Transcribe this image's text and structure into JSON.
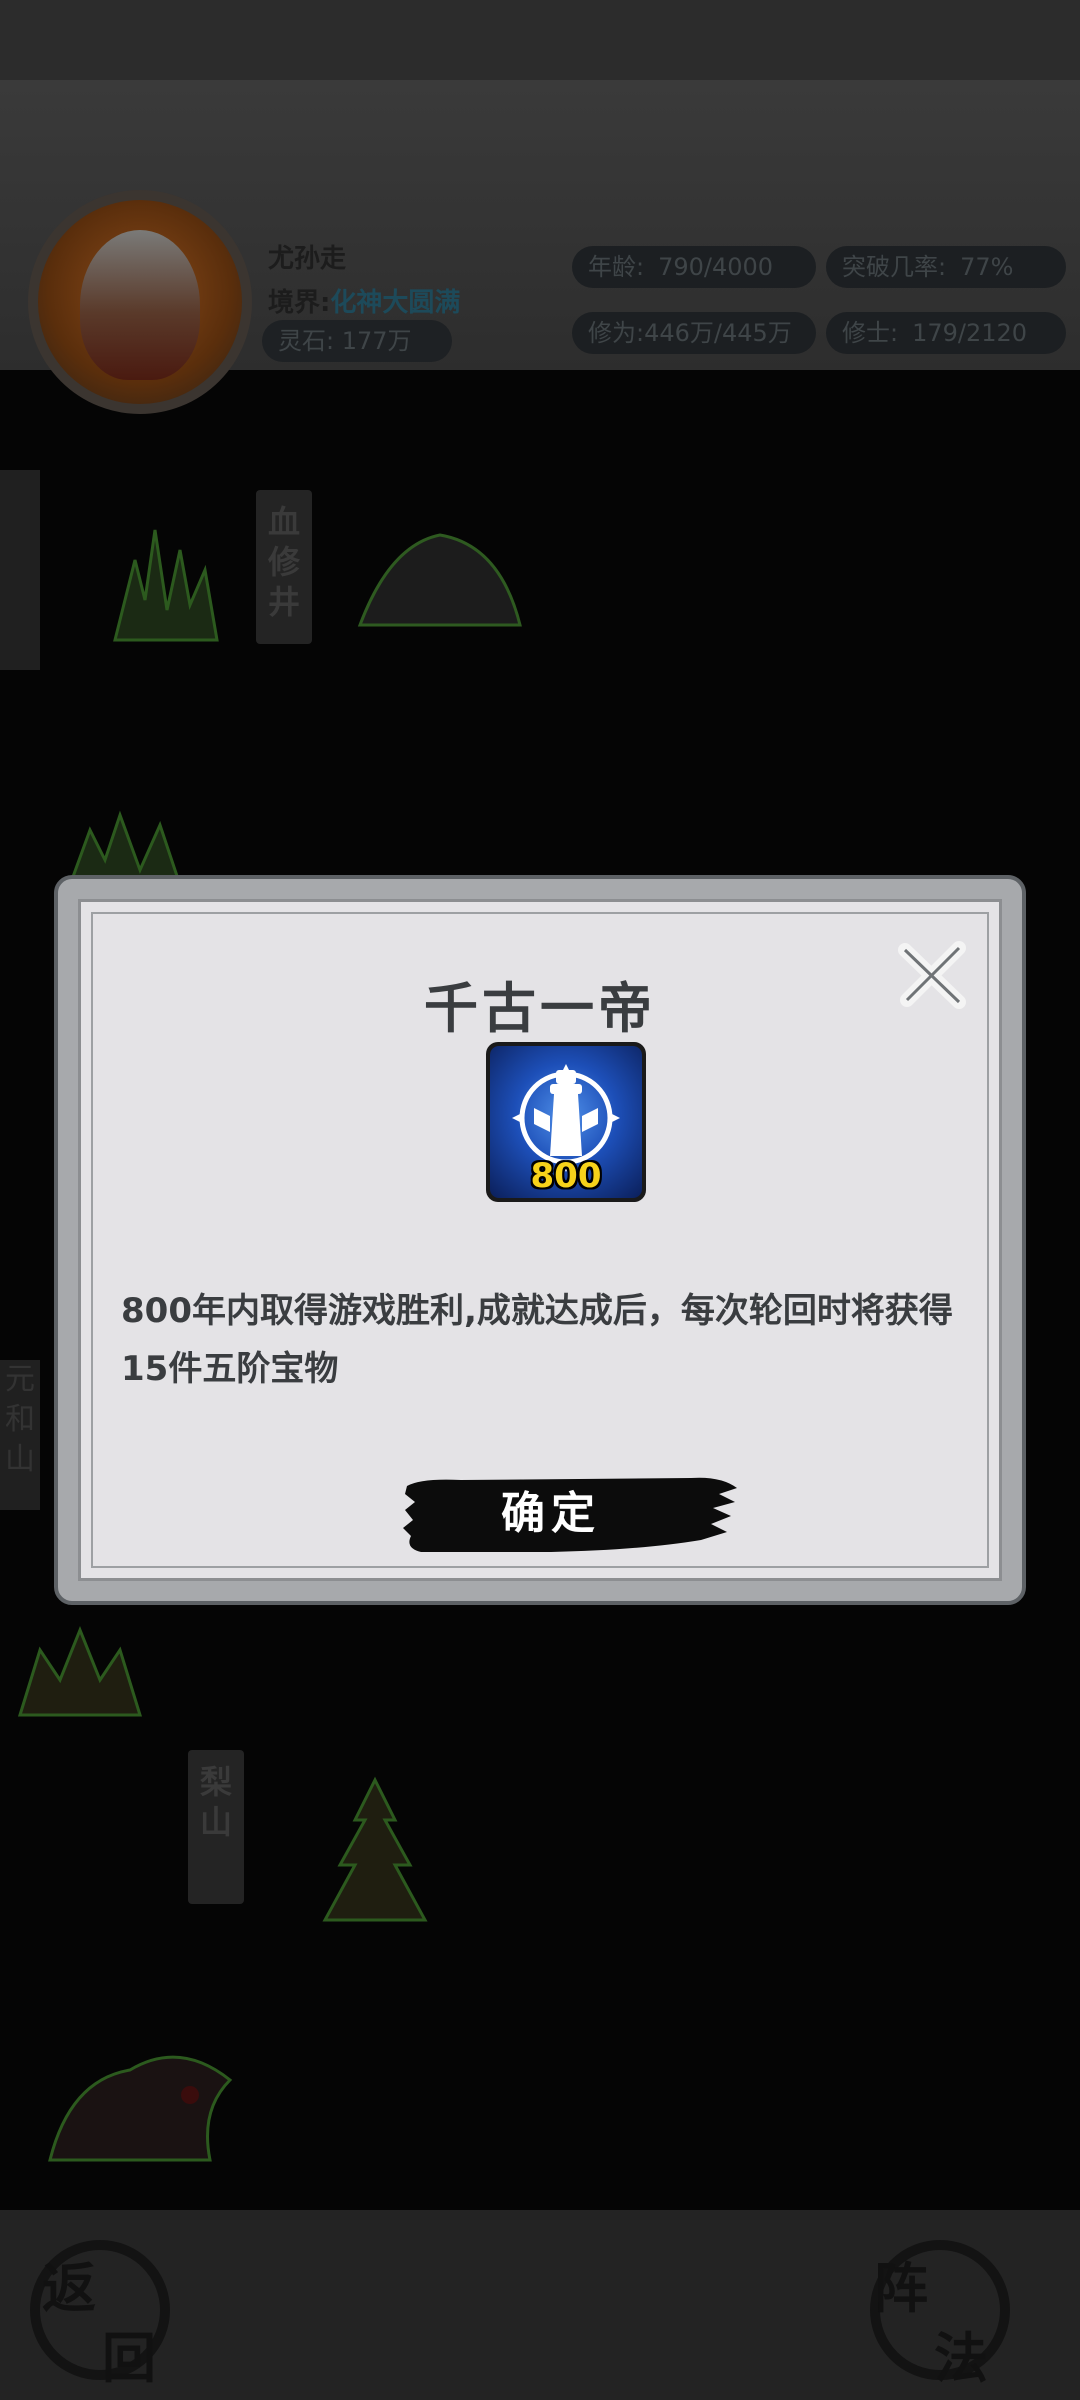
{
  "player": {
    "name": "尤孙走",
    "realm_label": "境界:",
    "realm_value": "化神大圆满",
    "spirit_stone": "灵石: 177万"
  },
  "stats": {
    "age_label": "年龄:",
    "age_value": "790/4000",
    "breakthrough_label": "突破几率:",
    "breakthrough_value": "77%",
    "cultivation_label": "修为:",
    "cultivation_value": "446万/445万",
    "disciples_label": "修士:",
    "disciples_value": "179/2120"
  },
  "map": {
    "locations": [
      "血修井",
      "元和山",
      "梨山"
    ]
  },
  "modal": {
    "title": "千古一帝",
    "badge_number": "800",
    "description": "800年内取得游戏胜利,成就达成后，每次轮回时将获得15件五阶宝物",
    "confirm_label": "确定",
    "close_icon": "close-x-icon"
  },
  "bottom": {
    "back_label_1": "返",
    "back_label_2": "回",
    "formation_label_1": "阵",
    "formation_label_2": "法"
  },
  "colors": {
    "modal_frame": "#a7a9ac",
    "modal_panel": "#e4e3e6",
    "text_dark": "#3a3d40",
    "badge_number": "#f6d21a",
    "badge_blue": "#1d4fb8"
  }
}
